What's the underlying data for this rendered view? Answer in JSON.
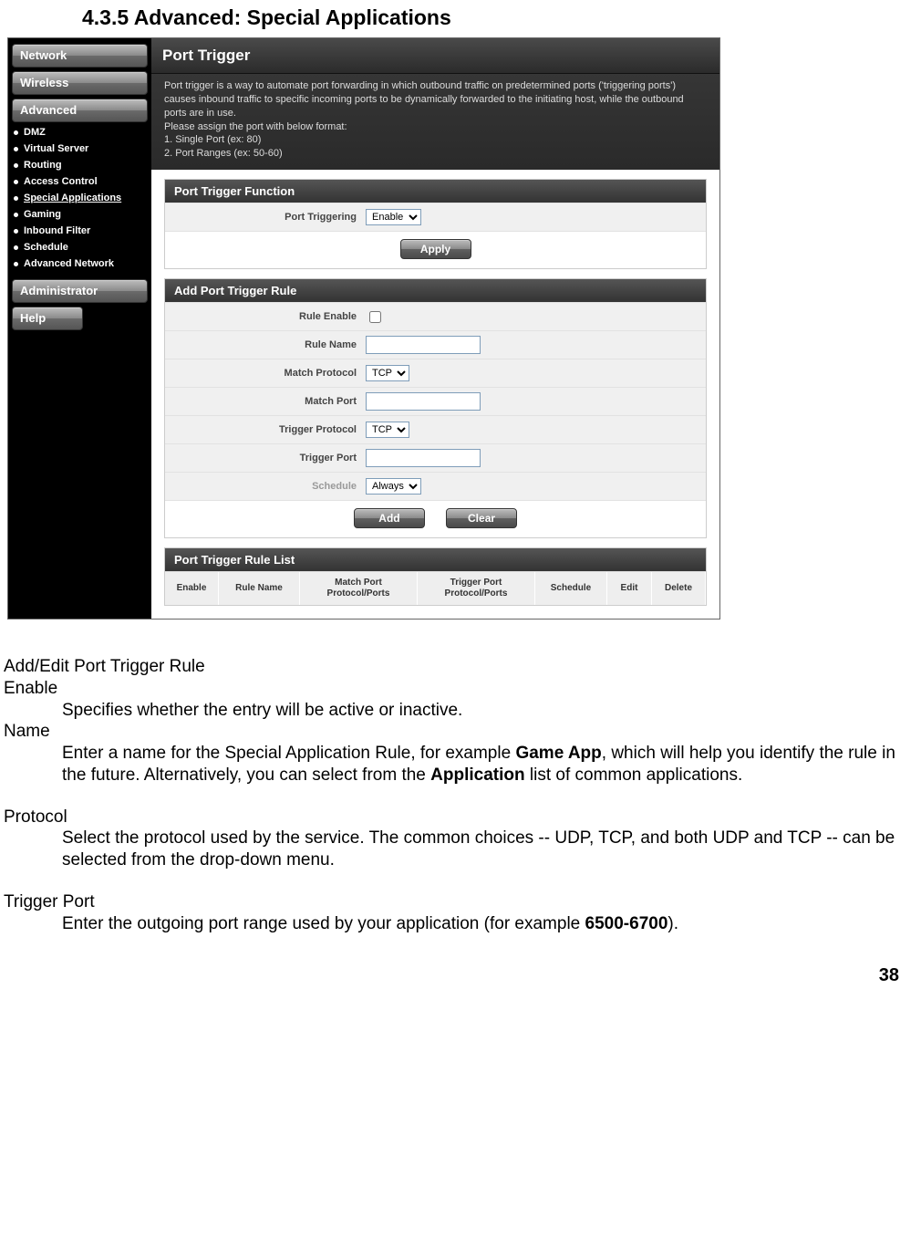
{
  "heading": "4.3.5 Advanced: Special Applications",
  "sidebar": {
    "network": "Network",
    "wireless": "Wireless",
    "advanced": "Advanced",
    "items": [
      "DMZ",
      "Virtual Server",
      "Routing",
      "Access Control",
      "Special Applications",
      "Gaming",
      "Inbound Filter",
      "Schedule",
      "Advanced Network"
    ],
    "administrator": "Administrator",
    "help": "Help"
  },
  "page_title": "Port Trigger",
  "intro": {
    "l1": "Port trigger is a way to automate port forwarding in which outbound traffic on predetermined ports ('triggering ports') causes inbound traffic to specific incoming ports to be dynamically forwarded to the initiating host, while the outbound ports are in use.",
    "l2": "Please assign the port with below format:",
    "l3": "1. Single Port (ex: 80)",
    "l4": "2. Port Ranges (ex: 50-60)"
  },
  "sec1": {
    "title": "Port Trigger Function",
    "label": "Port Triggering",
    "option": "Enable",
    "apply": "Apply"
  },
  "sec2": {
    "title": "Add Port Trigger Rule",
    "rule_enable": "Rule Enable",
    "rule_name": "Rule Name",
    "match_protocol": "Match Protocol",
    "match_port": "Match Port",
    "trigger_protocol": "Trigger Protocol",
    "trigger_port": "Trigger Port",
    "schedule": "Schedule",
    "opt_tcp": "TCP",
    "opt_always": "Always",
    "add": "Add",
    "clear": "Clear"
  },
  "sec3": {
    "title": "Port Trigger Rule List",
    "cols": {
      "enable": "Enable",
      "rule_name": "Rule Name",
      "match": "Match Port Protocol/Ports",
      "trigger": "Trigger Port Protocol/Ports",
      "schedule": "Schedule",
      "edit": "Edit",
      "delete": "Delete"
    }
  },
  "doc": {
    "h": "Add/Edit Port Trigger Rule",
    "enable_t": "Enable",
    "enable_d": "Specifies whether the entry will be active or inactive.",
    "name_t": "Name",
    "name_d1": "Enter a name for the Special Application Rule, for example ",
    "name_b1": "Game App",
    "name_d2": ", which will help you identify the rule in the future. Alternatively, you can select from the ",
    "name_b2": "Application",
    "name_d3": " list of common applications.",
    "proto_t": "Protocol",
    "proto_d": "Select the protocol used by the service. The common choices -- UDP, TCP, and both UDP and TCP -- can be selected from the drop-down menu.",
    "tport_t": "Trigger Port",
    "tport_d1": "Enter the outgoing port range used by your application (for example ",
    "tport_b": "6500-6700",
    "tport_d2": ")."
  },
  "pagenum": "38"
}
